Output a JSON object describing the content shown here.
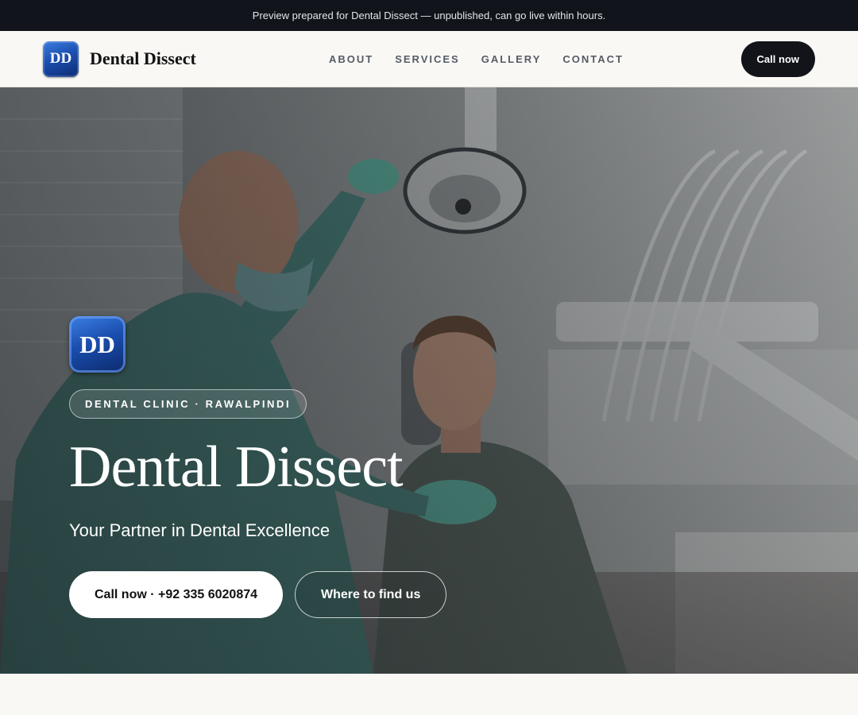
{
  "banner": {
    "text": "Preview prepared for Dental Dissect — unpublished, can go live within hours."
  },
  "brand": {
    "logo_text": "DD",
    "name": "Dental Dissect"
  },
  "nav": {
    "items": [
      {
        "label": "ABOUT"
      },
      {
        "label": "SERVICES"
      },
      {
        "label": "GALLERY"
      },
      {
        "label": "CONTACT"
      }
    ],
    "call_label": "Call now"
  },
  "hero": {
    "logo_text": "DD",
    "tagline_pill": "DENTAL CLINIC · RAWALPINDI",
    "title": "Dental Dissect",
    "subtitle": "Your Partner in Dental Excellence",
    "primary_cta": "Call now · +92 335 6020874",
    "secondary_cta": "Where to find us",
    "image_subject": "dentist-examining-smiling-patient-photo"
  },
  "colors": {
    "banner_bg": "#11141a",
    "page_bg": "#f9f8f5",
    "dark_button": "#12141a",
    "logo_blue": "#1b4fb0",
    "scrub_green": "#4f8f86"
  }
}
